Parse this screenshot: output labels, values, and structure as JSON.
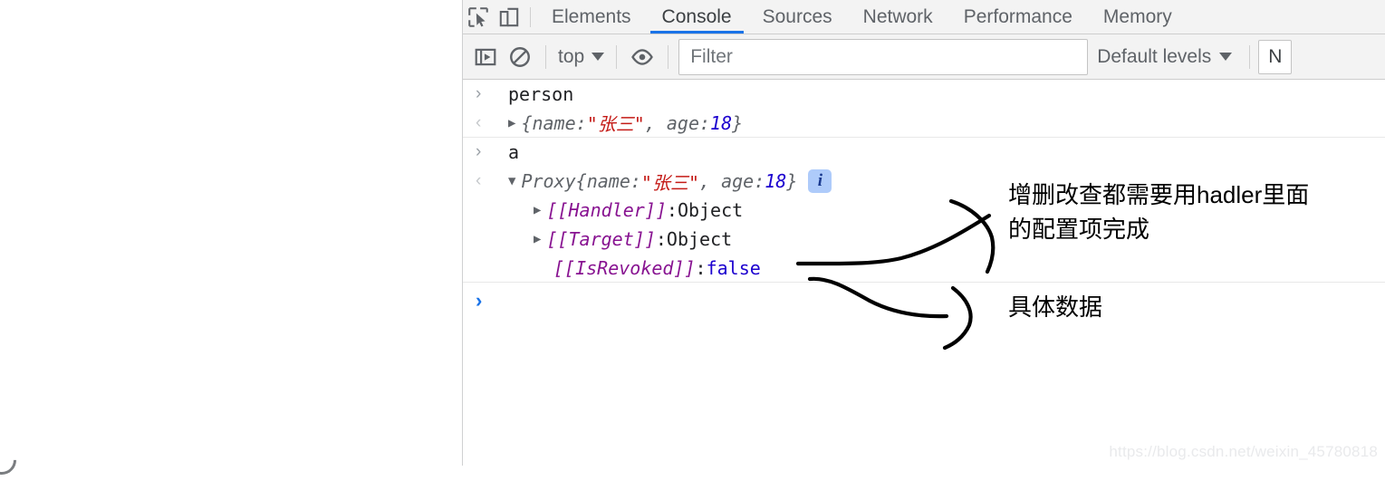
{
  "devtools": {
    "tabs": [
      {
        "label": "Elements",
        "active": false
      },
      {
        "label": "Console",
        "active": true
      },
      {
        "label": "Sources",
        "active": false
      },
      {
        "label": "Network",
        "active": false
      },
      {
        "label": "Performance",
        "active": false
      },
      {
        "label": "Memory",
        "active": false
      }
    ],
    "left_icons": [
      {
        "name": "inspect-element-icon"
      },
      {
        "name": "device-toolbar-icon"
      }
    ],
    "toolbar": {
      "sidebar_toggle_icon": "console-sidebar-icon",
      "clear_console_icon": "clear-console-icon",
      "context_selector": "top",
      "eye_icon": "live-expression-eye-icon",
      "filter_placeholder": "Filter",
      "filter_value": "",
      "levels_label": "Default levels",
      "issues_label": "N"
    }
  },
  "console": {
    "rows": [
      {
        "kind": "input",
        "gutter": "›",
        "text": "person"
      },
      {
        "kind": "output",
        "gutter": "‹",
        "disclosure": "closed",
        "segments": [
          {
            "text": "{name: ",
            "style": "gray-italic"
          },
          {
            "text": "\"张三\"",
            "style": "string"
          },
          {
            "text": ", age: ",
            "style": "gray-italic"
          },
          {
            "text": "18",
            "style": "number"
          },
          {
            "text": "}",
            "style": "gray-italic"
          }
        ]
      },
      {
        "kind": "input",
        "gutter": "›",
        "text": "a"
      },
      {
        "kind": "output",
        "gutter": "‹",
        "disclosure": "open",
        "segments": [
          {
            "text": "Proxy ",
            "style": "gray-italic"
          },
          {
            "text": "{name: ",
            "style": "gray-italic"
          },
          {
            "text": "\"张三\"",
            "style": "string"
          },
          {
            "text": ", age: ",
            "style": "gray-italic"
          },
          {
            "text": "18",
            "style": "number"
          },
          {
            "text": "}",
            "style": "gray-italic"
          }
        ],
        "badge": "i"
      }
    ],
    "proxy_properties": [
      {
        "disclosure": "closed",
        "key": "[[Handler]]",
        "sep": ": ",
        "value": "Object",
        "value_style": "plain"
      },
      {
        "disclosure": "closed",
        "key": "[[Target]]",
        "sep": ": ",
        "value": "Object",
        "value_style": "plain"
      },
      {
        "disclosure": "none",
        "key": "[[IsRevoked]]",
        "sep": ": ",
        "value": "false",
        "value_style": "bool"
      }
    ],
    "prompt": "›"
  },
  "annotations": [
    {
      "id": "anno1",
      "text": "增删改查都需要用hadler里面\n的配置项完成"
    },
    {
      "id": "anno2",
      "text": "具体数据"
    }
  ],
  "watermark": "https://blog.csdn.net/weixin_45780818",
  "colors": {
    "accent": "#1a73e8",
    "string": "#c41a16",
    "number": "#1c00cf",
    "internal_slot": "#881391",
    "toolbar_bg": "#f3f3f3",
    "info_badge_bg": "#aecbfa"
  }
}
